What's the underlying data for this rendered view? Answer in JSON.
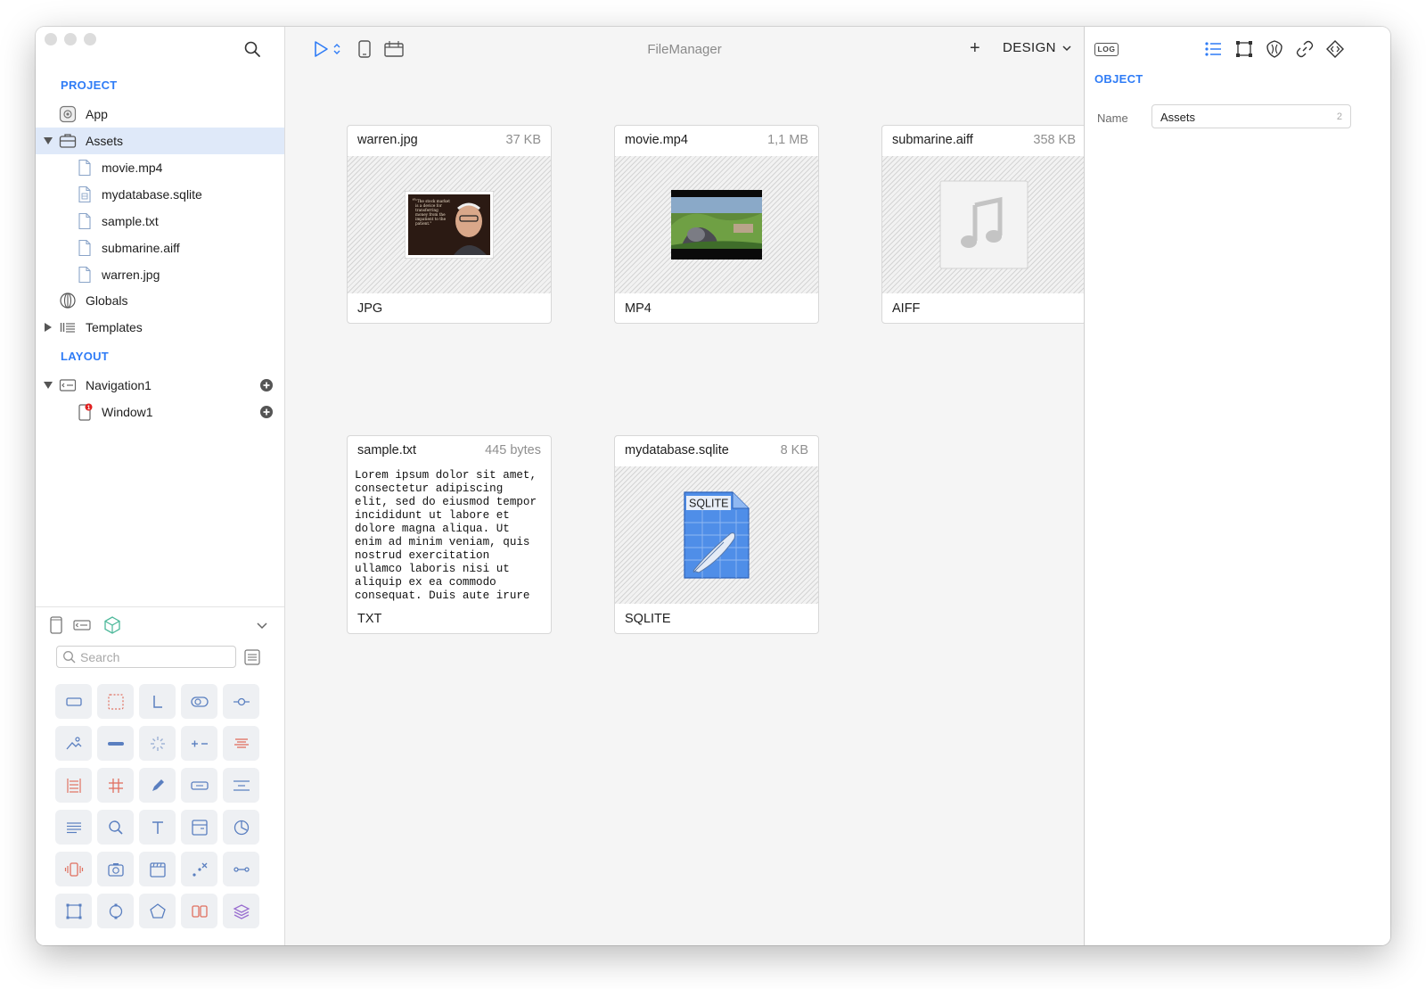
{
  "window": {
    "title": "FileManager"
  },
  "sidebar": {
    "project_title": "PROJECT",
    "layout_title": "LAYOUT",
    "project_items": [
      {
        "label": "App",
        "icon": "app-icon"
      },
      {
        "label": "Assets",
        "icon": "assets-icon",
        "expanded": true,
        "selected": true
      },
      {
        "label": "movie.mp4",
        "icon": "file-icon"
      },
      {
        "label": "mydatabase.sqlite",
        "icon": "database-file-icon"
      },
      {
        "label": "sample.txt",
        "icon": "file-icon"
      },
      {
        "label": "submarine.aiff",
        "icon": "file-icon"
      },
      {
        "label": "warren.jpg",
        "icon": "file-icon"
      },
      {
        "label": "Globals",
        "icon": "globe-icon"
      },
      {
        "label": "Templates",
        "icon": "templates-icon",
        "expanded": false
      }
    ],
    "layout_items": [
      {
        "label": "Navigation1",
        "icon": "navigation-icon",
        "expanded": true
      },
      {
        "label": "Window1",
        "icon": "window-icon",
        "badge": "1"
      }
    ]
  },
  "palette": {
    "search_placeholder": "Search",
    "components": [
      "view-icon",
      "selection-rect-icon",
      "label-icon",
      "toggle-icon",
      "slider-icon",
      "image-icon",
      "progress-icon",
      "spinner-icon",
      "stepper-icon",
      "align-icon",
      "table-icon",
      "grid-icon",
      "pen-icon",
      "button-icon",
      "divider-icon",
      "text-icon",
      "search-icon",
      "type-icon",
      "panel-icon",
      "chart-icon",
      "vibrate-icon",
      "camera-icon",
      "video-icon",
      "transform-icon",
      "link-icon",
      "frame-icon",
      "circle-icon",
      "shape-icon",
      "split-icon",
      "layers-icon"
    ]
  },
  "toolbar": {
    "add_label": "+",
    "mode_label": "DESIGN"
  },
  "assets": [
    {
      "name": "warren.jpg",
      "size": "37 KB",
      "type": "JPG",
      "preview": "photo"
    },
    {
      "name": "movie.mp4",
      "size": "1,1 MB",
      "type": "MP4",
      "preview": "video"
    },
    {
      "name": "submarine.aiff",
      "size": "358 KB",
      "type": "AIFF",
      "preview": "audio"
    },
    {
      "name": "sample.txt",
      "size": "445 bytes",
      "type": "TXT",
      "preview": "text",
      "text": "Lorem ipsum dolor sit amet,\nconsectetur adipiscing\nelit, sed do eiusmod tempor\nincididunt ut labore et\ndolore magna aliqua. Ut\nenim ad minim veniam, quis\nnostrud exercitation\nullamco laboris nisi ut\naliquip ex ea commodo\nconsequat. Duis aute irure"
    },
    {
      "name": "mydatabase.sqlite",
      "size": "8 KB",
      "type": "SQLITE",
      "preview": "sqlite",
      "preview_label": "SQLITE"
    }
  ],
  "photo_quote": "\"The stock market is a device for transferring money from the impatient to the patient.\"",
  "inspector": {
    "log_label": "LOG",
    "section_title": "OBJECT",
    "name_label": "Name",
    "name_value": "Assets",
    "name_count": "2"
  },
  "colors": {
    "accent": "#2f7cf6",
    "selection": "#dfe9f9",
    "badge": "#e02020"
  }
}
